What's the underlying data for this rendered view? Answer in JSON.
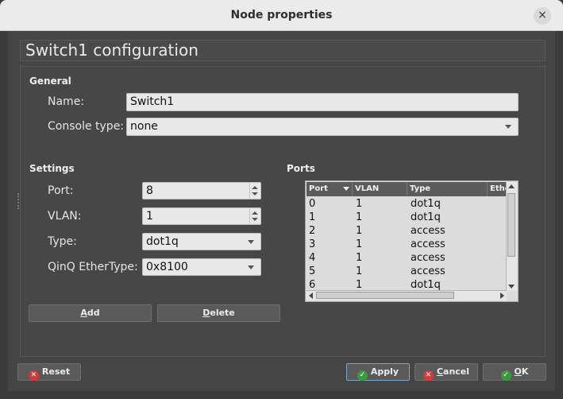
{
  "window": {
    "title": "Node properties",
    "close_glyph": "×"
  },
  "header": {
    "title": "Switch1 configuration"
  },
  "general": {
    "section_label": "General",
    "name_label": "Name:",
    "name_value": "Switch1",
    "console_label": "Console type:",
    "console_value": "none"
  },
  "settings": {
    "section_label": "Settings",
    "port_label": "Port:",
    "port_value": "8",
    "vlan_label": "VLAN:",
    "vlan_value": "1",
    "type_label": "Type:",
    "type_value": "dot1q",
    "qinq_label": "QinQ EtherType:",
    "qinq_value": "0x8100"
  },
  "ports": {
    "section_label": "Ports",
    "columns": [
      "Port",
      "VLAN",
      "Type",
      "Ethe"
    ],
    "rows": [
      {
        "port": "0",
        "vlan": "1",
        "type": "dot1q"
      },
      {
        "port": "1",
        "vlan": "1",
        "type": "dot1q"
      },
      {
        "port": "2",
        "vlan": "1",
        "type": "access"
      },
      {
        "port": "3",
        "vlan": "1",
        "type": "access"
      },
      {
        "port": "4",
        "vlan": "1",
        "type": "access"
      },
      {
        "port": "5",
        "vlan": "1",
        "type": "access"
      },
      {
        "port": "6",
        "vlan": "1",
        "type": "dot1q"
      }
    ]
  },
  "actions": {
    "add_mnemonic": "A",
    "add_rest": "dd",
    "delete_mnemonic": "D",
    "delete_rest": "elete"
  },
  "footer": {
    "reset_label": "Reset",
    "apply_label": "Apply",
    "cancel_mnemonic": "C",
    "cancel_rest": "ancel",
    "ok_mnemonic": "O",
    "ok_rest": "K"
  },
  "colors": {
    "background": "#454545",
    "titlebar": "#ebebeb",
    "field": "#e8e8e8",
    "danger": "#d33b3b",
    "success": "#3c9a3c"
  },
  "icons": {
    "reset": "x-circle-icon",
    "apply": "check-circle-icon",
    "cancel": "x-circle-icon",
    "ok": "check-circle-icon"
  }
}
